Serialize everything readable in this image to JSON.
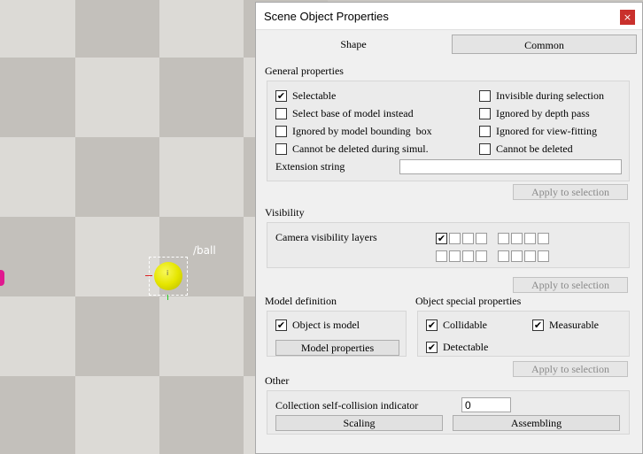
{
  "viewport": {
    "object_label": "/ball",
    "object_dot": "i"
  },
  "dialog": {
    "title": "Scene Object Properties",
    "close_glyph": "×",
    "tabs": [
      {
        "label": "Shape",
        "active": false
      },
      {
        "label": "Common",
        "active": true
      }
    ],
    "check_glyph": "✔",
    "general": {
      "heading": "General properties",
      "options": [
        {
          "label": "Selectable",
          "checked": true
        },
        {
          "label": "Invisible during selection",
          "checked": false
        },
        {
          "label": "Select base of model instead",
          "checked": false
        },
        {
          "label": "Ignored by depth pass",
          "checked": false
        },
        {
          "label": "Ignored by model bounding  box",
          "checked": false
        },
        {
          "label": "Ignored for view-fitting",
          "checked": false
        },
        {
          "label": "Cannot be deleted during simul.",
          "checked": false
        },
        {
          "label": "Cannot be deleted",
          "checked": false
        }
      ],
      "extension_label": "Extension string",
      "extension_value": "",
      "apply_label": "Apply to selection"
    },
    "visibility": {
      "heading": "Visibility",
      "camera_layers_label": "Camera visibility layers",
      "layers_row1": [
        true,
        false,
        false,
        false,
        false,
        false,
        false,
        false
      ],
      "layers_row2": [
        false,
        false,
        false,
        false,
        false,
        false,
        false,
        false
      ],
      "apply_label": "Apply to selection"
    },
    "model_definition": {
      "heading": "Model definition",
      "object_is_model_label": "Object is model",
      "object_is_model": true,
      "model_properties_label": "Model properties"
    },
    "special": {
      "heading": "Object special properties",
      "options": [
        {
          "label": "Collidable",
          "checked": true
        },
        {
          "label": "Measurable",
          "checked": true
        },
        {
          "label": "Detectable",
          "checked": true
        }
      ],
      "apply_label": "Apply to selection"
    },
    "other": {
      "heading": "Other",
      "collision_label": "Collection self-collision indicator",
      "collision_value": "0",
      "scaling_label": "Scaling",
      "assembling_label": "Assembling"
    }
  }
}
